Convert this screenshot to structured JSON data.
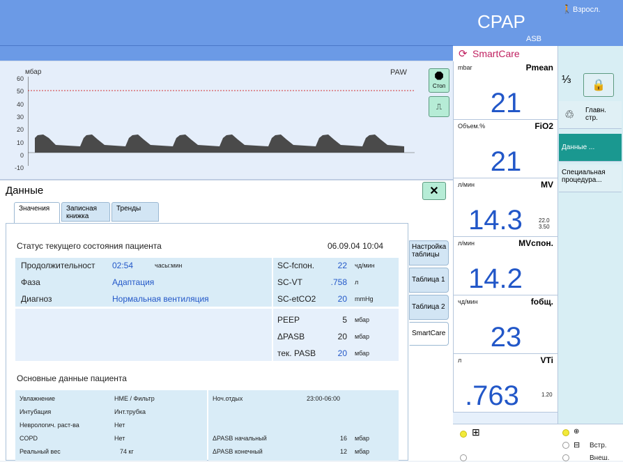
{
  "mode": {
    "title": "CPAP",
    "sub": "ASB"
  },
  "patient": {
    "label": "Взросл."
  },
  "smartcare": {
    "label": "SmartCare"
  },
  "waveform": {
    "unit": "мбар",
    "name": "PAW",
    "y_ticks": [
      "60",
      "50",
      "40",
      "30",
      "20",
      "10",
      "0",
      "-10"
    ]
  },
  "wave_buttons": {
    "stop": "Стоп"
  },
  "panel": {
    "title": "Данные"
  },
  "tabs": [
    "Значения",
    "Записная книжка",
    "Тренды"
  ],
  "right_tabs": [
    "Настройка таблицы",
    "Таблица 1",
    "Таблица 2",
    "SmartCare"
  ],
  "status": {
    "title": "Статус текущего состояния пациента",
    "datetime": "06.09.04  10:04"
  },
  "status_rows": [
    {
      "label": "Продолжительност",
      "value": "02:54",
      "unit": "часы:мин"
    },
    {
      "label": "Фаза",
      "value": "Адаптация"
    },
    {
      "label": "Диагноз",
      "value": "Нормальная вентиляция"
    }
  ],
  "sc_rows": [
    {
      "label": "SC-fспон.",
      "value": "22",
      "unit": "чд/мин"
    },
    {
      "label": "SC-VT",
      "value": ".758",
      "unit": "л"
    },
    {
      "label": "SC-etCO2",
      "value": "20",
      "unit": "mmHg"
    }
  ],
  "peep_rows": [
    {
      "label": "PEEP",
      "value": "5",
      "unit": "мбар"
    },
    {
      "label": "ΔPASB",
      "value": "20",
      "unit": "мбар"
    },
    {
      "label": "тек. PASB",
      "value": "20",
      "unit": "мбар"
    }
  ],
  "basic": {
    "title": "Основные данные пациента"
  },
  "basic_rows": [
    {
      "label": "Увлажнение",
      "value": "HME / Фильтр"
    },
    {
      "label": "Интубация",
      "value": "Инт.трубка"
    },
    {
      "label": "Неврологич. раст-ва",
      "value": "Нет"
    },
    {
      "label": "COPD",
      "value": "Нет"
    },
    {
      "label": "Реальный вес",
      "value": "74  кг"
    }
  ],
  "basic_rows2": [
    {
      "label": "Ноч.отдых",
      "value": "23:00-06:00",
      "unit": ""
    },
    {
      "label": "ΔPASB начальный",
      "value": "16",
      "unit": "мбар"
    },
    {
      "label": "ΔPASB конечный",
      "value": "12",
      "unit": "мбар"
    }
  ],
  "meters": [
    {
      "unit": "mbar",
      "name": "Pmean",
      "value": "21",
      "extra": ""
    },
    {
      "unit": "Объем.%",
      "name": "FiO2",
      "value": "21",
      "extra": ""
    },
    {
      "unit": "л/мин",
      "name": "MV",
      "value": "14.3",
      "extra": "22.0 3.50"
    },
    {
      "unit": "л/мин",
      "name": "MVспон.",
      "value": "14.2",
      "extra": ""
    },
    {
      "unit": "чд/мин",
      "name": "fобщ.",
      "value": "23",
      "extra": ""
    },
    {
      "unit": "л",
      "name": "VTi",
      "value": ".763",
      "extra": "1.20"
    }
  ],
  "side_buttons": [
    "Главн. стр.",
    "Данные ...",
    "Специальная процедура..."
  ],
  "bottom": {
    "in": "Встр.",
    "out": "Внеш."
  },
  "colors": {
    "header": "#6b9ae6",
    "accent": "#2257c8",
    "teal": "#1a9890",
    "wave": "#4a4a4a",
    "limit": "#d23030"
  }
}
